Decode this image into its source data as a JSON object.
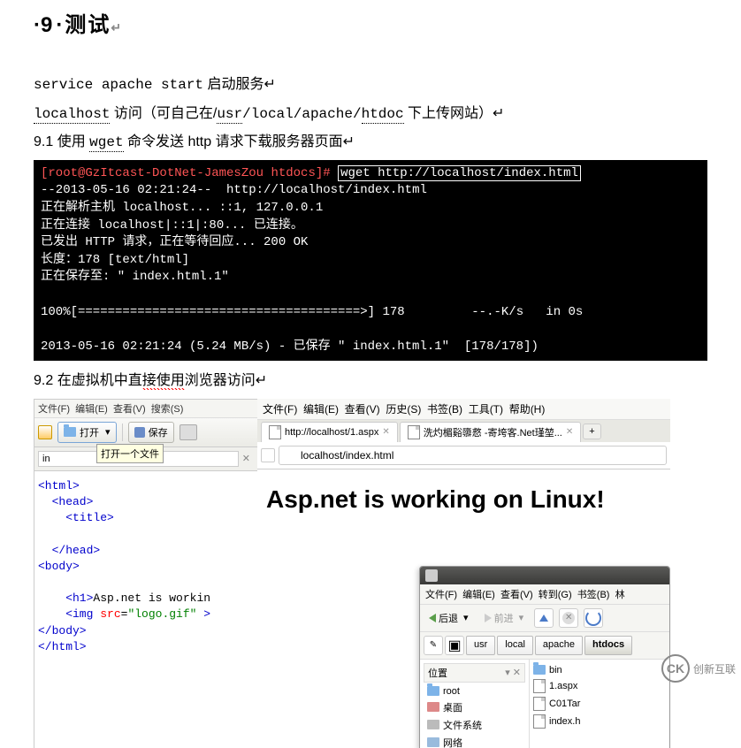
{
  "heading": {
    "bullet": "·",
    "num": "9",
    "sep": "·",
    "title": "测试",
    "tail": "↵"
  },
  "intro": {
    "l1_cmd": "service apache start",
    "l1_txt": " 启动服务↵",
    "l2a": "localhost",
    "l2b": " 访问（可自己在/",
    "l2c": "usr",
    "l2d": "/local/apache/",
    "l2e": "htdoc",
    "l2f": " 下上传网站）↵",
    "l3a": "9.1 使用 ",
    "l3b": "wget",
    "l3c": " 命令发送 http 请求下载服务器页面↵"
  },
  "terminal": {
    "prompt": "[root@GzItcast-DotNet-JamesZou htdocs]#",
    "cmd": "wget http://localhost/index.html",
    "l2": "--2013-05-16 02:21:24--  http://localhost/index.html",
    "l3": "正在解析主机 localhost... ::1, 127.0.0.1",
    "l4": "正在连接 localhost|::1|:80... 已连接。",
    "l5": "已发出 HTTP 请求，正在等待回应... 200 OK",
    "l6": "长度：178 [text/html]",
    "l7": "正在保存至: \" index.html.1\"",
    "l8": "",
    "l9": "100%[======================================>] 178         --.-K/s   in 0s",
    "l10": "",
    "l11": "2013-05-16 02:21:24 (5.24 MB/s) - 已保存 \" index.html.1\"  [178/178])"
  },
  "sec92": {
    "a": "9.2 在虚拟机中直",
    "b": "接使用",
    "c": "浏览器访问↵"
  },
  "leftpane": {
    "menu": [
      "文件(F)",
      "编辑(E)",
      "查看(V)",
      "搜索(S)"
    ],
    "open": "打开",
    "save": "保存",
    "tooltip": "打开一个文件",
    "filename": "in",
    "code_lines": {
      "l1": "<html>",
      "l2": "  <head>",
      "l3": "    <title>",
      "l4": "",
      "l5": "  </head>",
      "l6": "<body>",
      "l7": "",
      "l8a": "    <h1>",
      "l8b": "Asp.net is workin",
      "l9a": "    <img ",
      "l9b": "src",
      "l9c": "=",
      "l9d": "\"logo.gif\"",
      "l9e": " >",
      "l10": "</body>",
      "l11": "</html>"
    }
  },
  "browser": {
    "menu": [
      "文件(F)",
      "编辑(E)",
      "查看(V)",
      "历史(S)",
      "书签(B)",
      "工具(T)",
      "帮助(H)"
    ],
    "tab1": "http://localhost/1.aspx",
    "tab2": "洗灼楣谿隳慦 -寄垮客.Net瑾堃...",
    "url": "localhost/index.html",
    "page_title": "Asp.net is working on Linux!"
  },
  "fm": {
    "menu": [
      "文件(F)",
      "编辑(E)",
      "查看(V)",
      "转到(G)",
      "书签(B)",
      "林"
    ],
    "back": "后退",
    "forward": "前进",
    "crumbs": [
      "usr",
      "local",
      "apache",
      "htdocs"
    ],
    "side_header": "位置",
    "side_items": [
      "root",
      "桌面",
      "文件系统",
      "网络"
    ],
    "files": [
      "bin",
      "1.aspx",
      "C01Tar",
      "index.h"
    ]
  },
  "watermark": {
    "logo": "CK",
    "text": "创新互联"
  }
}
